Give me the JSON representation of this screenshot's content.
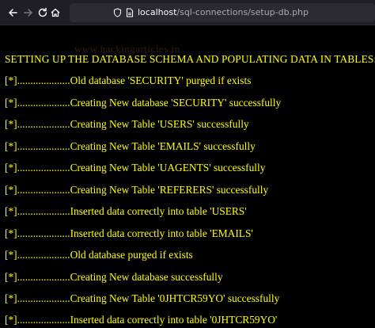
{
  "browser": {
    "url_host": "localhost",
    "url_path": "/sql-connections/setup-db.php",
    "icons": [
      "back-icon",
      "forward-icon",
      "reload-icon",
      "home-icon",
      "shield-icon",
      "page-icon"
    ]
  },
  "page": {
    "watermark": "www.hackingarticles.in",
    "heading": "SETTING UP THE DATABASE SCHEMA AND POPULATING DATA IN TABLES:",
    "lines": [
      "[*]....................Old database 'SECURITY' purged if exists",
      "[*]....................Creating New database 'SECURITY' successfully",
      "[*]....................Creating New Table 'USERS' successfully",
      "[*]....................Creating New Table 'EMAILS' successfully",
      "[*]....................Creating New Table 'UAGENTS' successfully",
      "[*]....................Creating New Table 'REFERERS' successfully",
      "[*]....................Inserted data correctly into table 'USERS'",
      "[*]....................Inserted data correctly into table 'EMAILS'",
      "[*]....................Old database purged if exists",
      "[*]....................Creating New database successfully",
      "[*]....................Creating New Table '0JHTCR59YO' successfully",
      "[*]....................Inserted data correctly into table '0JHTCR59YO'"
    ]
  },
  "colors": {
    "text": "#ffff00",
    "background": "#000000",
    "toolbar": "#1f1e25"
  }
}
